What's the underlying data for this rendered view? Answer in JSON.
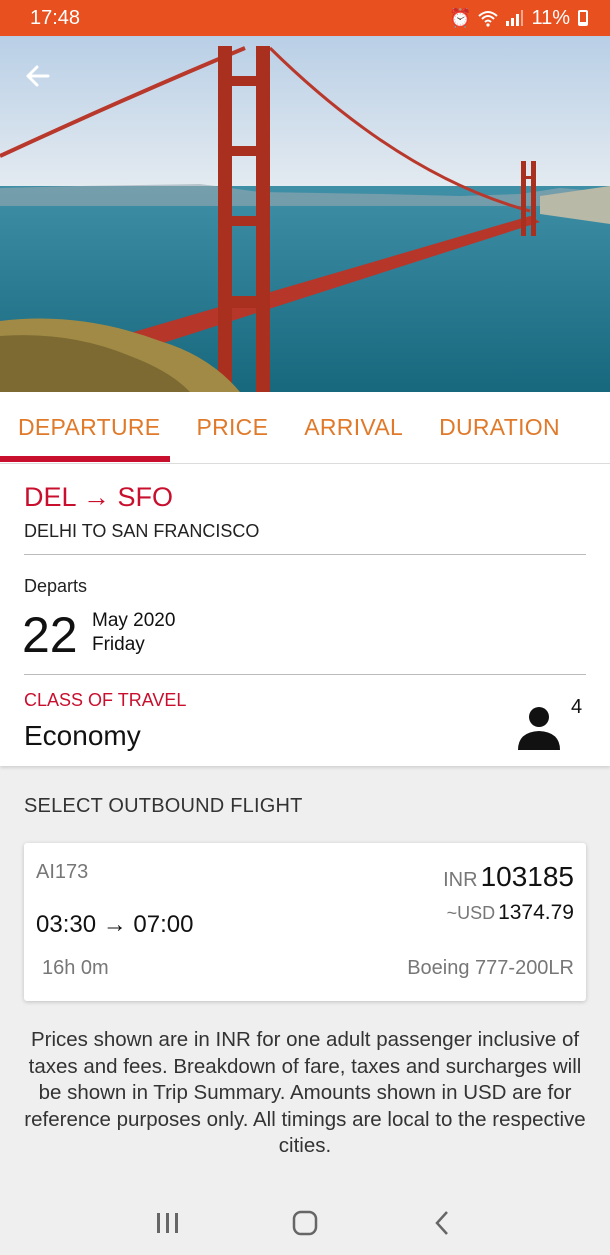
{
  "status_bar": {
    "time": "17:48",
    "battery": "11%",
    "icons": [
      "alarm-icon",
      "wifi-icon",
      "signal-icon",
      "battery-icon"
    ]
  },
  "hero": {
    "back_icon": "arrow-left-icon"
  },
  "tabs": [
    {
      "label": "DEPARTURE",
      "active": true
    },
    {
      "label": "PRICE",
      "active": false
    },
    {
      "label": "ARRIVAL",
      "active": false
    },
    {
      "label": "DURATION",
      "active": false
    }
  ],
  "trip": {
    "route_code": "DEL → SFO",
    "route_full": "DELHI TO SAN FRANCISCO",
    "departs_label": "Departs",
    "day": "22",
    "month_year": "May 2020",
    "weekday": "Friday",
    "class_label": "CLASS OF TRAVEL",
    "class_value": "Economy",
    "passenger_count": "4"
  },
  "results": {
    "title": "SELECT OUTBOUND FLIGHT",
    "flights": [
      {
        "flight_number": "AI173",
        "currency_inr": "INR",
        "price_inr": "103185",
        "currency_usd": "~USD",
        "price_usd": "1374.79",
        "times": "03:30 → 07:00",
        "duration": "16h 0m",
        "aircraft": "Boeing 777-200LR"
      }
    ]
  },
  "disclaimer": "Prices shown are in INR for one adult passenger inclusive of taxes and fees. Breakdown of fare, taxes and surcharges will be shown in Trip Summary. Amounts shown in USD are for reference purposes only. All timings are local to the respective cities.",
  "colors": {
    "status_bar": "#e8501f",
    "accent_red": "#c8102e",
    "tab_orange": "#e07a2a"
  }
}
